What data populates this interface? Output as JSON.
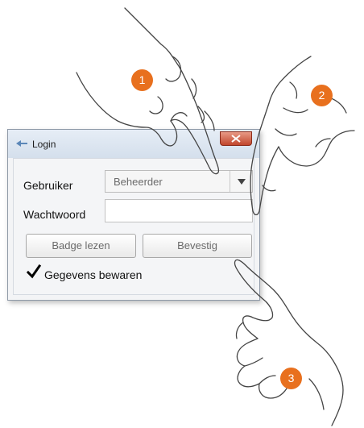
{
  "window": {
    "title": "Login",
    "close_icon": "close-icon"
  },
  "form": {
    "user_label": "Gebruiker",
    "user_value": "Beheerder",
    "password_label": "Wachtwoord",
    "password_value": "",
    "badge_button": "Badge lezen",
    "confirm_button": "Bevestig",
    "remember_label": "Gegevens bewaren",
    "remember_checked": true
  },
  "steps": [
    "1",
    "2",
    "3"
  ],
  "colors": {
    "badge": "#e8701e",
    "close_button": "#c1462d",
    "titlebar": "#dbe5f1"
  }
}
